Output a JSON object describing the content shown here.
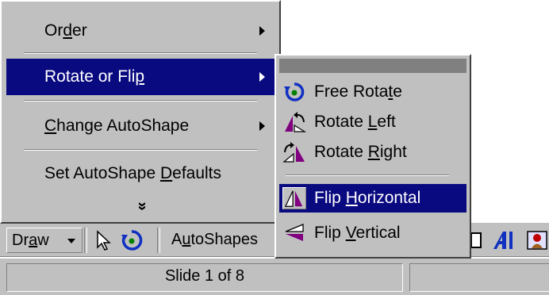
{
  "draw_menu": {
    "items": [
      {
        "label_pre": "Or",
        "label_key": "d",
        "label_post": "er",
        "has_submenu": true
      },
      {
        "label_pre": "Rotate or Fli",
        "label_key": "p",
        "label_post": "",
        "has_submenu": true
      },
      {
        "label_pre": "",
        "label_key": "C",
        "label_post": "hange AutoShape",
        "has_submenu": true
      },
      {
        "label_pre": "Set AutoShape ",
        "label_key": "D",
        "label_post": "efaults",
        "has_submenu": false
      }
    ],
    "expand_glyph": "»"
  },
  "rotate_flip_submenu": {
    "items": [
      {
        "label_pre": "Free Rota",
        "label_key": "t",
        "label_post": "e",
        "icon": "free-rotate-icon"
      },
      {
        "label_pre": "Rotate ",
        "label_key": "L",
        "label_post": "eft",
        "icon": "rotate-left-icon"
      },
      {
        "label_pre": "Rotate ",
        "label_key": "R",
        "label_post": "ight",
        "icon": "rotate-right-icon"
      },
      {
        "label_pre": "Flip ",
        "label_key": "H",
        "label_post": "orizontal",
        "icon": "flip-horizontal-icon"
      },
      {
        "label_pre": "Flip ",
        "label_key": "V",
        "label_post": "ertical",
        "icon": "flip-vertical-icon"
      }
    ]
  },
  "drawing_toolbar": {
    "draw_pre": "Dr",
    "draw_key": "a",
    "draw_post": "w",
    "autoshapes_pre": "A",
    "autoshapes_key": "u",
    "autoshapes_post": "toShapes"
  },
  "status_bar": {
    "slide_info": "Slide 1 of 8"
  },
  "colors": {
    "highlight": "#0a0a80",
    "face": "#c0c0c0",
    "icon_blue": "#1030c0",
    "icon_purple": "#800080",
    "icon_green": "#008000"
  }
}
